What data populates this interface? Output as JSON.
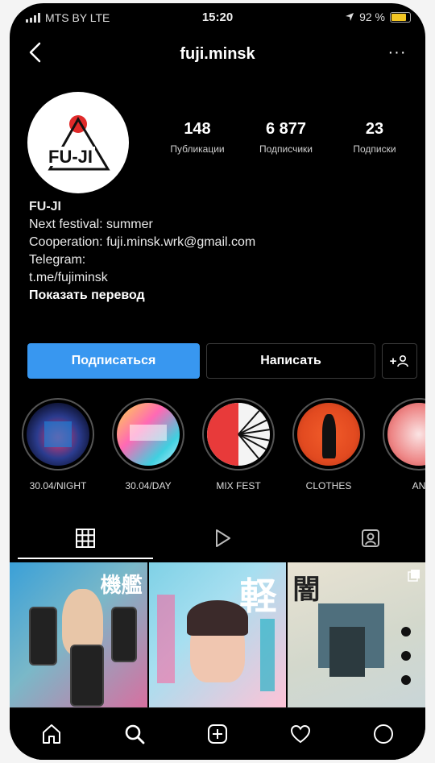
{
  "status_bar": {
    "carrier": "MTS BY  LTE",
    "time": "15:20",
    "battery": "92 %",
    "battery_level": 0.92,
    "battery_color": "#f3c623"
  },
  "header": {
    "username": "fuji.minsk",
    "back_icon": "chevron-left-icon",
    "more_icon": "more-dots-icon",
    "more_label": "···"
  },
  "profile": {
    "avatar_text": "FU-JI",
    "stats": [
      {
        "value": "148",
        "label": "Публикации"
      },
      {
        "value": "6 877",
        "label": "Подписчики"
      },
      {
        "value": "23",
        "label": "Подписки"
      }
    ],
    "bio": {
      "name": "FU-JI",
      "line1": "Next festival: summer",
      "line2": "Cooperation: fuji.minsk.wrk@gmail.com",
      "line3": "Telegram:",
      "line4": "t.me/fujiminsk",
      "translate": "Показать перевод"
    }
  },
  "actions": {
    "follow": "Подписаться",
    "message": "Написать",
    "add_person": "+",
    "accent_color": "#3897f0"
  },
  "highlights": [
    {
      "label": "30.04/NIGHT"
    },
    {
      "label": "30.04/DAY"
    },
    {
      "label": "MIX FEST"
    },
    {
      "label": "CLOTHES"
    },
    {
      "label": "AN"
    }
  ],
  "tabs": [
    {
      "icon": "grid-icon"
    },
    {
      "icon": "reels-play-icon"
    },
    {
      "icon": "tagged-person-icon"
    }
  ],
  "posts": [
    {
      "glyph": "機艦"
    },
    {
      "glyph": "軽"
    },
    {
      "glyph": "闇"
    }
  ],
  "bottom_nav": [
    {
      "icon": "home-icon"
    },
    {
      "icon": "search-icon"
    },
    {
      "icon": "new-post-icon"
    },
    {
      "icon": "heart-icon"
    },
    {
      "icon": "profile-icon"
    }
  ]
}
